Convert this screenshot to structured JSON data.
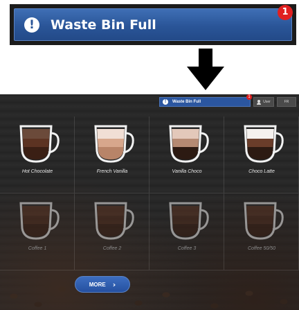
{
  "zoom": {
    "title": "Waste Bin Full",
    "badge": "1"
  },
  "topbar": {
    "alert_title": "Waste Bin Full",
    "badge": "1",
    "user_label": "User",
    "lang_label": "FR"
  },
  "drinks": [
    {
      "label": "Hot Chocolate",
      "layers": [
        "#3a1f14",
        "#5c3322",
        "#6b4a3a"
      ],
      "enabled": true
    },
    {
      "label": "French Vanilla",
      "layers": [
        "#b88468",
        "#d7a78c",
        "#f1dfd5"
      ],
      "enabled": true
    },
    {
      "label": "Vanilla Choco",
      "layers": [
        "#2c1a12",
        "#b58a73",
        "#e3c8ba"
      ],
      "enabled": true
    },
    {
      "label": "Choco Latte",
      "layers": [
        "#2c1a12",
        "#6a3d2a",
        "#f5f1ee"
      ],
      "enabled": true
    },
    {
      "label": "Coffee 1",
      "layers": [
        "#3a1f14",
        "#4e2b1c",
        "#5b3423"
      ],
      "enabled": false
    },
    {
      "label": "Coffee 2",
      "layers": [
        "#3a1f14",
        "#4e2b1c",
        "#5b3423"
      ],
      "enabled": false
    },
    {
      "label": "Coffee 3",
      "layers": [
        "#3a1f14",
        "#4e2b1c",
        "#5b3423"
      ],
      "enabled": false
    },
    {
      "label": "Coffee 50/50",
      "layers": [
        "#3a1f14",
        "#4e2b1c",
        "#5b3423"
      ],
      "enabled": false
    }
  ],
  "more_button": {
    "label": "MORE"
  },
  "colors": {
    "accent": "#2a5598",
    "badge": "#e02020"
  }
}
